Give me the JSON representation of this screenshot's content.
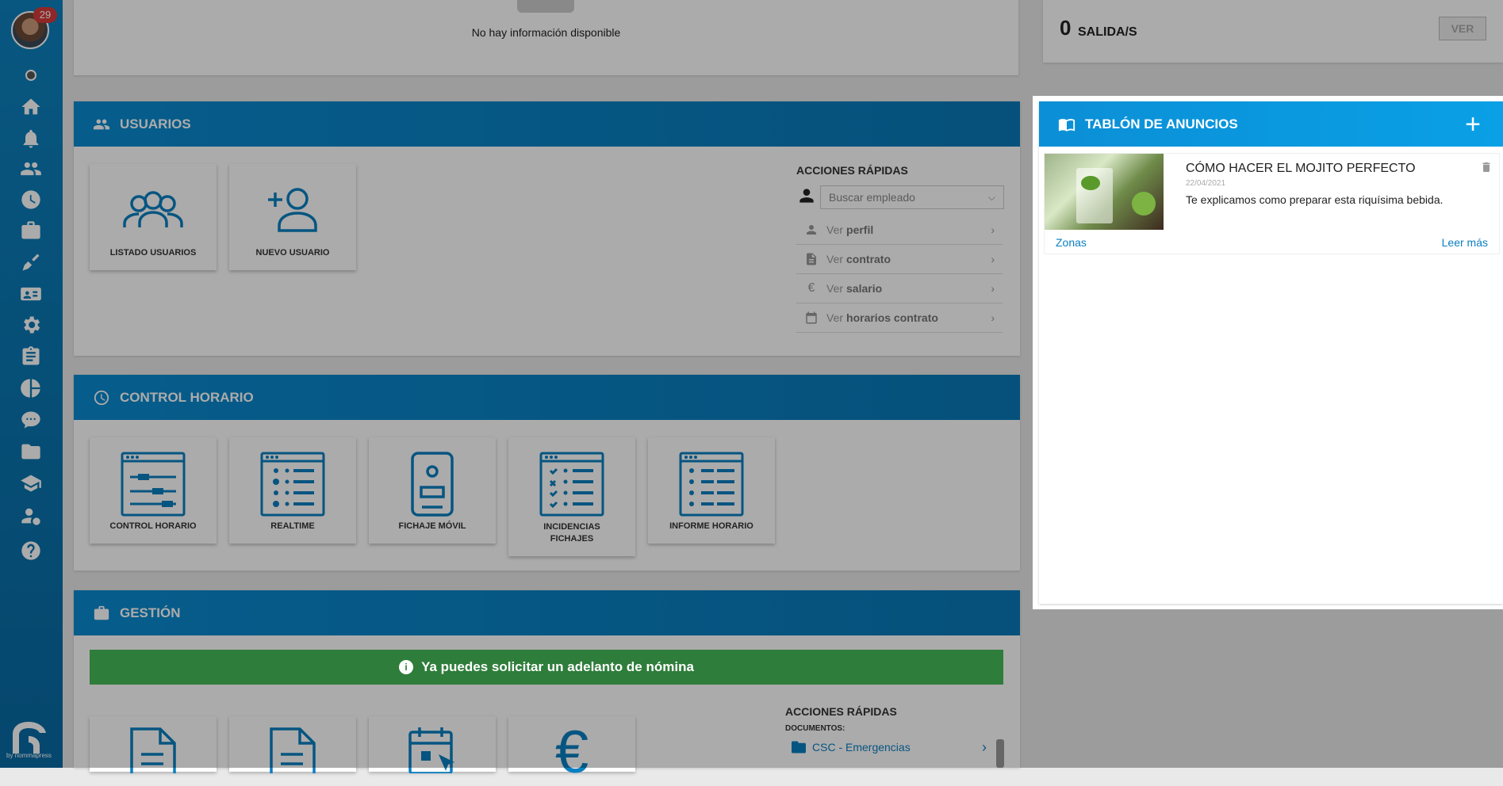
{
  "sidebar": {
    "notifications": "29",
    "brand": "by nommapress"
  },
  "top_left": {
    "empty_text": "No hay información disponible"
  },
  "top_right": {
    "count": "0",
    "count_label": "SALIDA/S",
    "button": "VER"
  },
  "usuarios": {
    "title": "USUARIOS",
    "tiles": [
      "LISTADO USUARIOS",
      "NUEVO USUARIO"
    ],
    "quick_title": "ACCIONES RÁPIDAS",
    "search_placeholder": "Buscar empleado",
    "actions": [
      {
        "pre": "Ver",
        "bold": "perfil"
      },
      {
        "pre": "Ver",
        "bold": "contrato"
      },
      {
        "pre": "Ver",
        "bold": "salario"
      },
      {
        "pre": "Ver",
        "bold": "horarios contrato"
      }
    ]
  },
  "control": {
    "title": "CONTROL HORARIO",
    "tiles": [
      "CONTROL HORARIO",
      "REALTIME",
      "FICHAJE MÓVIL",
      "INCIDENCIAS FICHAJES",
      "INFORME HORARIO"
    ]
  },
  "gestion": {
    "title": "GESTIÓN",
    "banner": "Ya puedes solicitar un adelanto de nómina",
    "quick_title": "ACCIONES RÁPIDAS",
    "documents_label": "DOCUMENTOS:",
    "document": "CSC - Emergencias"
  },
  "tablon": {
    "title": "TABLÓN DE ANUNCIOS",
    "post": {
      "title": "CÓMO HACER EL MOJITO PERFECTO",
      "date": "22/04/2021",
      "text": "Te explicamos como preparar esta riquísima bebida.",
      "tag": "Zonas",
      "more": "Leer más"
    }
  }
}
